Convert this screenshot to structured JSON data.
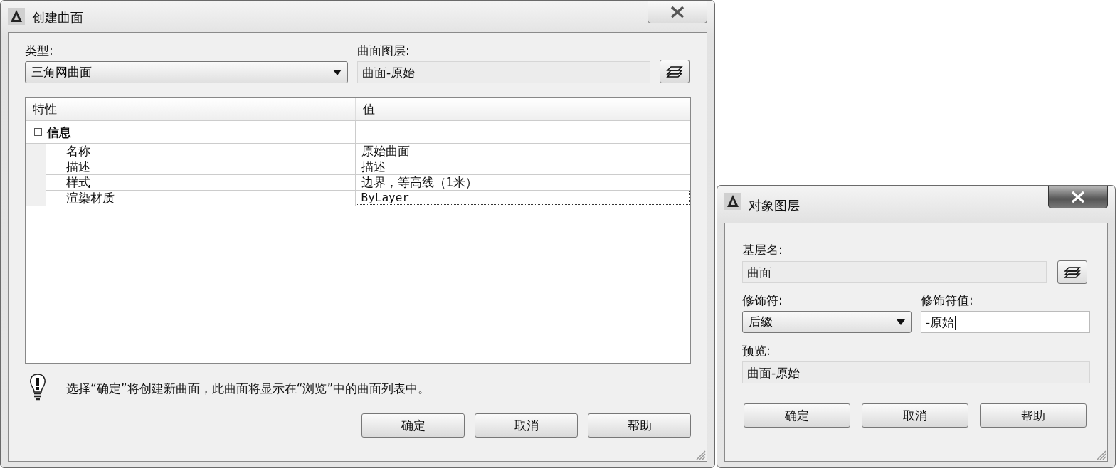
{
  "create_surface_dialog": {
    "title": "创建曲面",
    "active": false,
    "type_label": "类型:",
    "type_value": "三角网曲面",
    "layer_label": "曲面图层:",
    "layer_value": "曲面-原始",
    "properties": {
      "columns": [
        "特性",
        "值"
      ],
      "categories": [
        {
          "name": "信息",
          "expanded": true,
          "children": [
            {
              "name": "名称",
              "value": "原始曲面",
              "selected": false
            },
            {
              "name": "描述",
              "value": "描述",
              "selected": false
            },
            {
              "name": "样式",
              "value": "边界，等高线（1米）",
              "selected": false
            },
            {
              "name": "渲染材质",
              "value": "ByLayer",
              "selected": true
            }
          ]
        }
      ]
    },
    "hint": "选择“确定”将创建新曲面，此曲面将显示在“浏览”中的曲面列表中。",
    "buttons": [
      "确定",
      "取消",
      "帮助"
    ]
  },
  "object_layer_dialog": {
    "title": "对象图层",
    "active": true,
    "base_layer_label": "基层名:",
    "base_layer_value": "曲面",
    "modifier_label": "修饰符:",
    "modifier_value": "后缀",
    "modifier_value_label": "修饰符值:",
    "modifier_value_value": "-原始",
    "preview_label": "预览:",
    "preview_value": "曲面-原始",
    "buttons": [
      "确定",
      "取消",
      "帮助"
    ]
  }
}
